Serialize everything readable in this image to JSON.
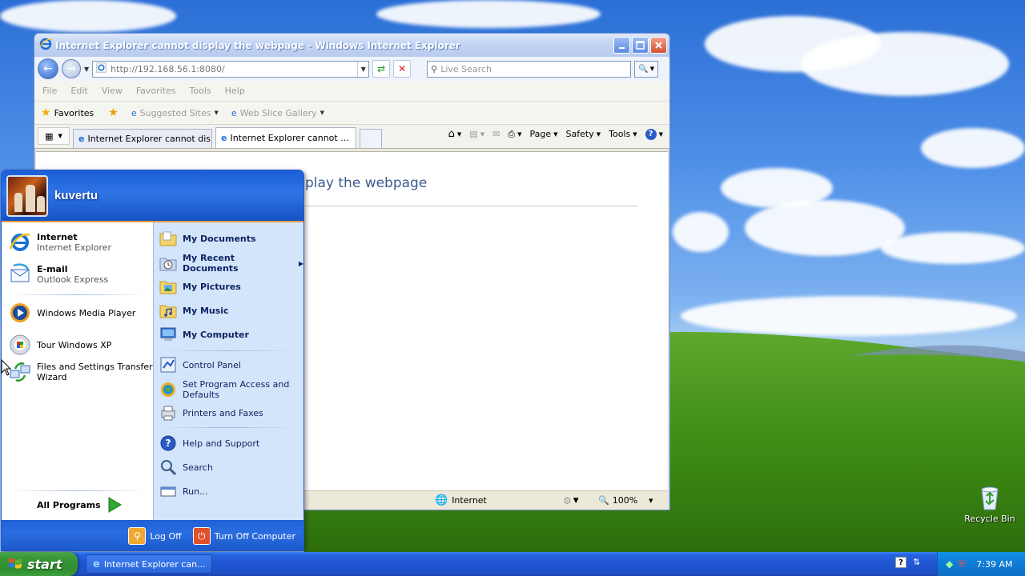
{
  "desktop": {
    "recycle_bin_label": "Recycle Bin"
  },
  "ie": {
    "window_title": "Internet Explorer cannot display the webpage - Windows Internet Explorer",
    "address_value": "http://192.168.56.1:8080/",
    "address_host": "192.168.56.1",
    "search_placeholder": "Live Search",
    "menu": [
      "File",
      "Edit",
      "View",
      "Favorites",
      "Tools",
      "Help"
    ],
    "favorites_label": "Favorites",
    "suggested_sites": "Suggested Sites",
    "web_slice_gallery": "Web Slice Gallery",
    "tabs": [
      {
        "label": "Internet Explorer cannot dis..."
      },
      {
        "label": "Internet Explorer cannot ..."
      }
    ],
    "commands": {
      "page": "Page",
      "safety": "Safety",
      "tools": "Tools"
    },
    "content_heading_visible": "play the webpage",
    "status": {
      "zone": "Internet",
      "zoom": "100%"
    }
  },
  "start_menu": {
    "username": "kuvertu",
    "left_items": [
      {
        "title": "Internet",
        "subtitle": "Internet Explorer"
      },
      {
        "title": "E-mail",
        "subtitle": "Outlook Express"
      },
      {
        "title": "Windows Media Player"
      },
      {
        "title": "Tour Windows XP"
      },
      {
        "title": "Files and Settings Transfer Wizard",
        "line1": "Files and Settings Transfer",
        "line2": "Wizard"
      }
    ],
    "all_programs": "All Programs",
    "right_items": [
      {
        "label": "My Documents"
      },
      {
        "label": "My Recent Documents"
      },
      {
        "label": "My Pictures"
      },
      {
        "label": "My Music"
      },
      {
        "label": "My Computer"
      },
      {
        "label": "Control Panel"
      },
      {
        "label": "Set Program Access and Defaults",
        "line1": "Set Program Access and",
        "line2": "Defaults"
      },
      {
        "label": "Printers and Faxes"
      },
      {
        "label": "Help and Support"
      },
      {
        "label": "Search"
      },
      {
        "label": "Run..."
      }
    ],
    "log_off": "Log Off",
    "turn_off": "Turn Off Computer"
  },
  "taskbar": {
    "start_label": "start",
    "task_item": "Internet Explorer can...",
    "clock": "7:39 AM"
  },
  "colors": {
    "taskbar_blue": "#2155d2",
    "start_green": "#3a9a3a",
    "start_menu_right": "#d3e5fa"
  }
}
